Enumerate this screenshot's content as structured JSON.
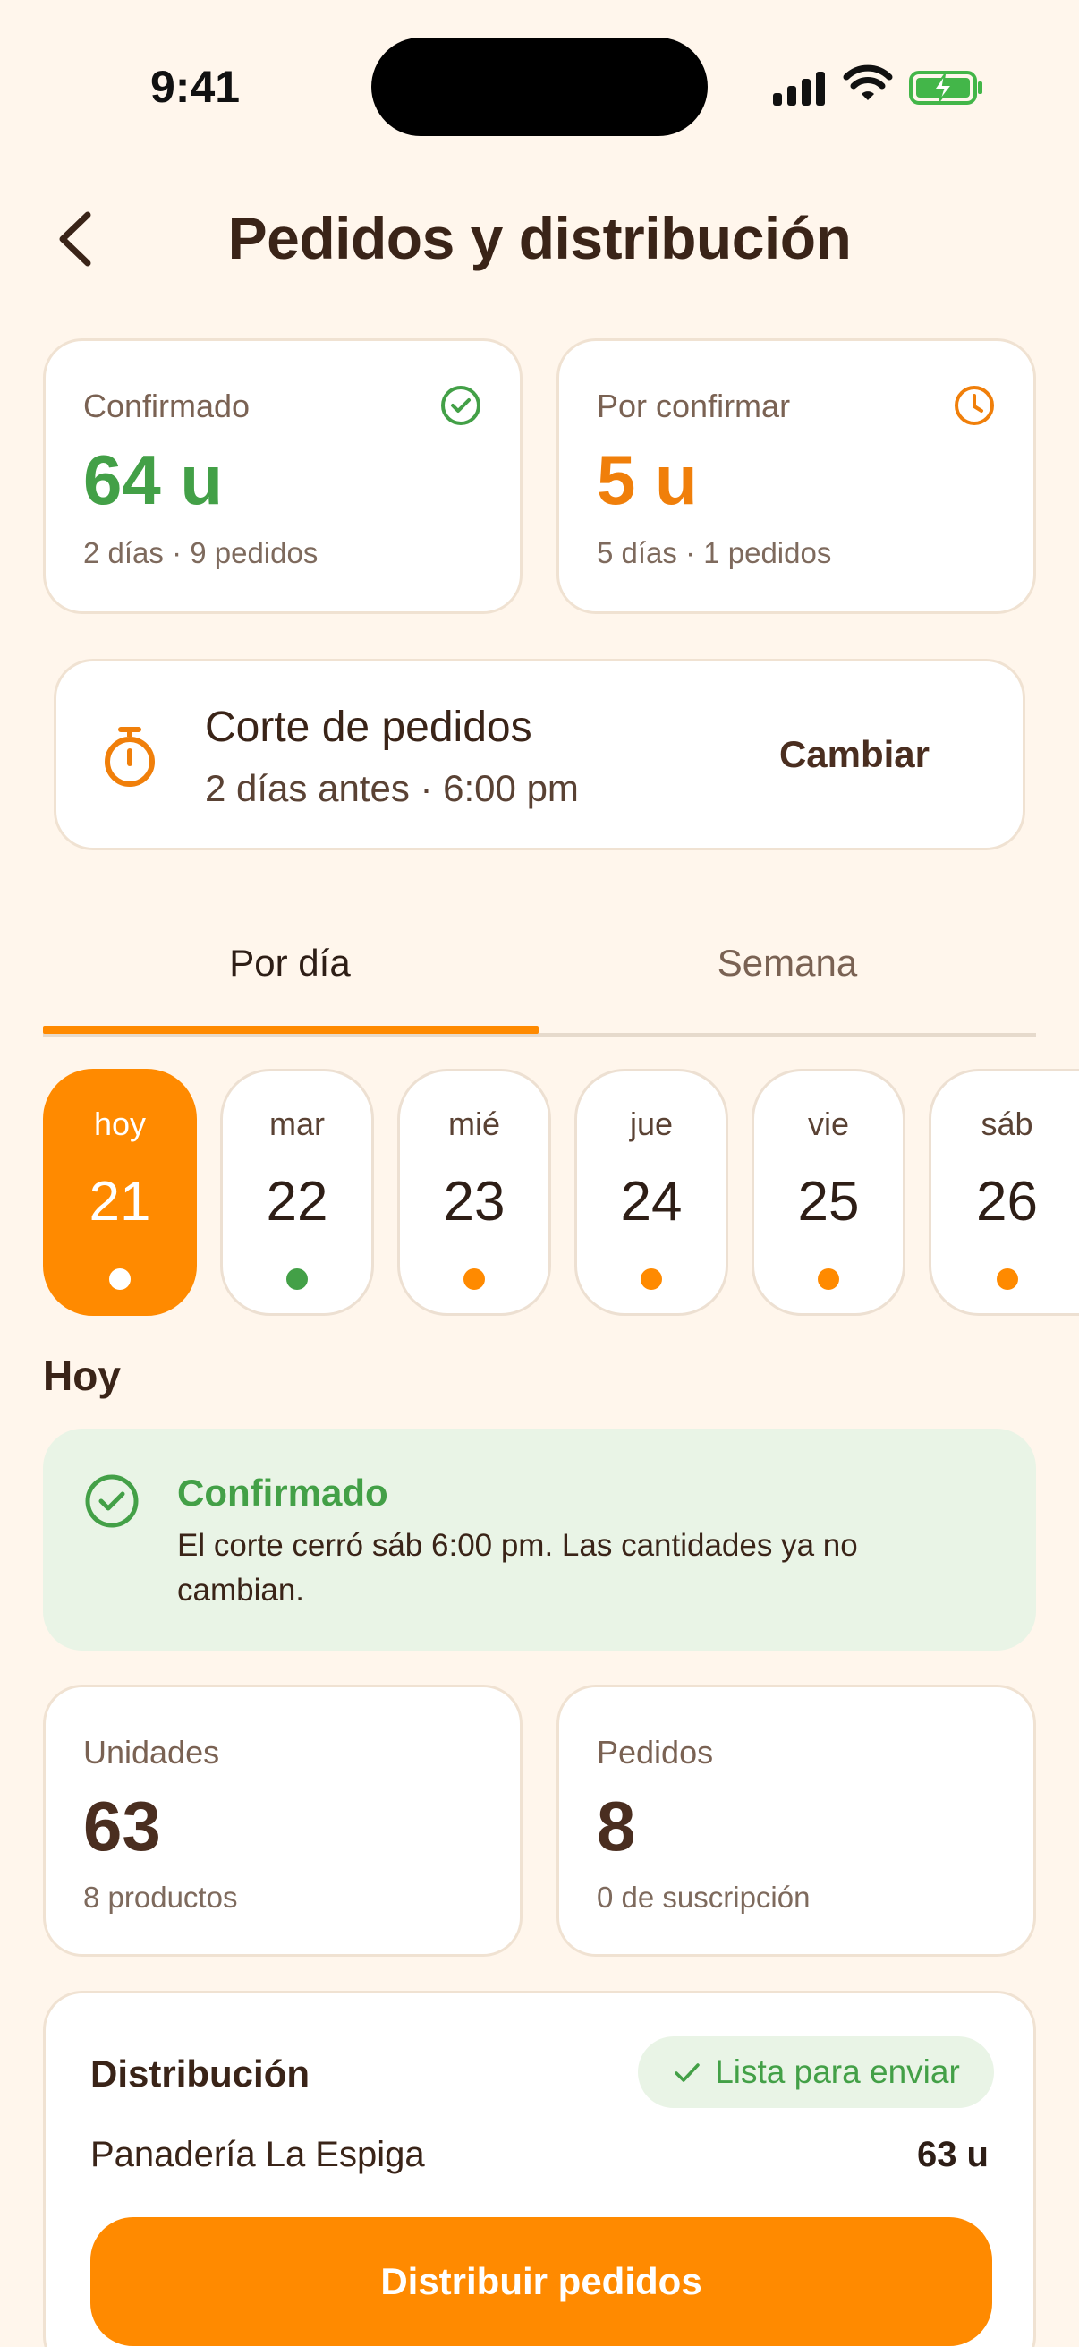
{
  "status_bar": {
    "time": "9:41"
  },
  "header": {
    "title": "Pedidos y distribución"
  },
  "summary": {
    "confirmed": {
      "label": "Confirmado",
      "value": "64 u",
      "sub": "2 días · 9 pedidos",
      "icon": "check-circle-icon",
      "color": "#43A047"
    },
    "pending": {
      "label": "Por confirmar",
      "value": "5 u",
      "sub": "5 días · 1 pedidos",
      "icon": "clock-icon",
      "color": "#F07F0A"
    }
  },
  "cutoff": {
    "title": "Corte de pedidos",
    "detail": "2 días antes · 6:00 pm",
    "action": "Cambiar",
    "icon": "stopwatch-icon"
  },
  "tabs": [
    {
      "label": "Por día",
      "active": true
    },
    {
      "label": "Semana",
      "active": false
    }
  ],
  "days": [
    {
      "name": "hoy",
      "num": "21",
      "active": true,
      "dot": "#FFFFFF"
    },
    {
      "name": "mar",
      "num": "22",
      "active": false,
      "dot": "#43A047"
    },
    {
      "name": "mié",
      "num": "23",
      "active": false,
      "dot": "#FF8A00"
    },
    {
      "name": "jue",
      "num": "24",
      "active": false,
      "dot": "#FF8A00"
    },
    {
      "name": "vie",
      "num": "25",
      "active": false,
      "dot": "#FF8A00"
    },
    {
      "name": "sáb",
      "num": "26",
      "active": false,
      "dot": "#FF8A00"
    }
  ],
  "section_title": "Hoy",
  "banner": {
    "title": "Confirmado",
    "body": "El corte cerró sáb 6:00 pm. Las cantidades ya no cambian."
  },
  "stats": {
    "units": {
      "label": "Unidades",
      "value": "63",
      "sub": "8 productos"
    },
    "orders": {
      "label": "Pedidos",
      "value": "8",
      "sub": "0 de suscripción"
    }
  },
  "distribution": {
    "title": "Distribución",
    "badge": "Lista para enviar",
    "bakery": "Panadería La Espiga",
    "units": "63 u",
    "cta": "Distribuir pedidos"
  },
  "colors": {
    "accent": "#FF8A00",
    "success": "#43A047",
    "background": "#FFF6EC"
  }
}
